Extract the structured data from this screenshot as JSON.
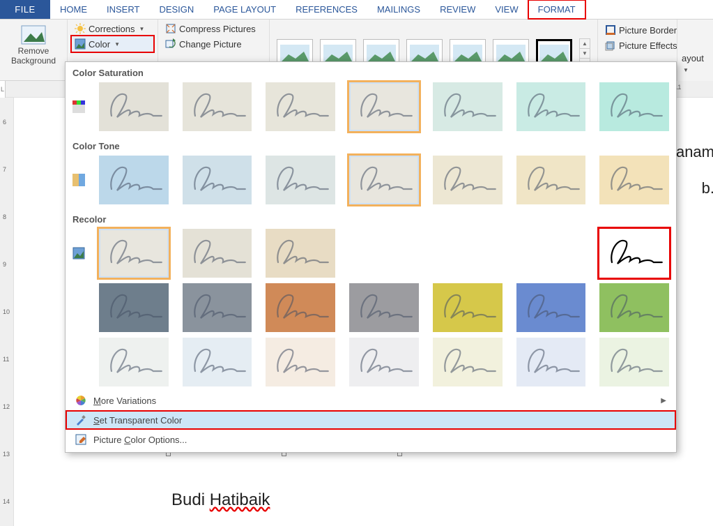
{
  "tabs": {
    "file": "FILE",
    "home": "HOME",
    "insert": "INSERT",
    "design": "DESIGN",
    "page_layout": "PAGE LAYOUT",
    "references": "REFERENCES",
    "mailings": "MAILINGS",
    "review": "REVIEW",
    "view": "VIEW",
    "format": "FORMAT"
  },
  "ribbon": {
    "remove_bg_line1": "Remove",
    "remove_bg_line2": "Background",
    "corrections": "Corrections",
    "color": "Color",
    "compress_pictures": "Compress Pictures",
    "change_picture": "Change Picture",
    "picture_border": "Picture Border",
    "picture_effects": "Picture Effects",
    "picture_layout_partial": "ayout"
  },
  "popup": {
    "color_saturation": "Color Saturation",
    "color_tone": "Color Tone",
    "recolor": "Recolor",
    "more_variations": "More Variations",
    "set_transparent_color": "Set Transparent Color",
    "picture_color_options": "Picture Color Options...",
    "accel_more": "M",
    "accel_set": "S",
    "accel_opts": "C",
    "saturation_items": [
      {
        "bg": "#e3e1d8",
        "sel": false
      },
      {
        "bg": "#e6e4da",
        "sel": false
      },
      {
        "bg": "#e7e5da",
        "sel": false
      },
      {
        "bg": "#e8e6de",
        "sel": true
      },
      {
        "bg": "#d7eae4",
        "sel": false
      },
      {
        "bg": "#c9ebe4",
        "sel": false
      },
      {
        "bg": "#b8eadf",
        "sel": false
      }
    ],
    "tone_items": [
      {
        "bg": "#bcd8ea",
        "sel": false
      },
      {
        "bg": "#cfe0e9",
        "sel": false
      },
      {
        "bg": "#dde5e4",
        "sel": false
      },
      {
        "bg": "#e8e6de",
        "sel": true
      },
      {
        "bg": "#ede7d3",
        "sel": false
      },
      {
        "bg": "#f0e5c6",
        "sel": false
      },
      {
        "bg": "#f3e2b9",
        "sel": false
      }
    ],
    "recolor_row1": [
      {
        "bg": "#e8e6de",
        "sel": true,
        "hl": false
      },
      {
        "bg": "#e4e1d6",
        "sel": false,
        "hl": false
      },
      {
        "bg": "#e8dcc4",
        "sel": false,
        "hl": false
      },
      {
        "bg": "#ffffff",
        "sel": false,
        "hl": false,
        "empty": true
      },
      {
        "bg": "#ffffff",
        "sel": false,
        "hl": false,
        "empty": true
      },
      {
        "bg": "#ffffff",
        "sel": false,
        "hl": false,
        "empty": true
      },
      {
        "bg": "#ffffff",
        "sel": false,
        "hl": true,
        "black": true
      }
    ],
    "recolor_row2": [
      {
        "bg": "#6e7e8c"
      },
      {
        "bg": "#8a939d"
      },
      {
        "bg": "#d08a58"
      },
      {
        "bg": "#9c9ca0"
      },
      {
        "bg": "#d6c84a"
      },
      {
        "bg": "#6a8bd0"
      },
      {
        "bg": "#8fc060"
      }
    ],
    "recolor_row3": [
      {
        "bg": "#eef1ef"
      },
      {
        "bg": "#e5edf3"
      },
      {
        "bg": "#f5ece2"
      },
      {
        "bg": "#eeeef0"
      },
      {
        "bg": "#f2f1dd"
      },
      {
        "bg": "#e4eaf5"
      },
      {
        "bg": "#ebf3e2"
      }
    ]
  },
  "document": {
    "partial1": "lanam",
    "partial2": "b.",
    "name_plain": "Budi ",
    "name_wavy": "Hatibaik"
  },
  "ruler": {
    "corner": "L",
    "h_marks": [
      "11"
    ],
    "v_marks": [
      "6",
      "7",
      "8",
      "9",
      "10",
      "11",
      "12",
      "13",
      "14"
    ]
  }
}
